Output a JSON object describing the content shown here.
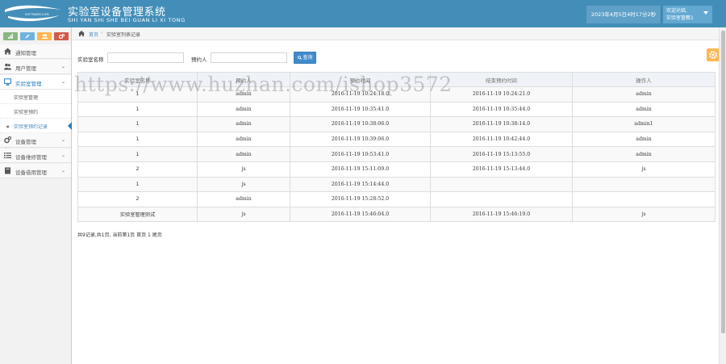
{
  "header": {
    "logo_text": "SOFTWARE.COM",
    "title": "实验室设备管理系统",
    "subtitle": "SHI YAN SHI SHE BEI GUAN LI XI TONG",
    "datetime": "2023年4月5日4时17分2秒",
    "welcome": "欢迎光临,",
    "username": "实验室管教1"
  },
  "sidebar": {
    "items": [
      {
        "label": "通知管理"
      },
      {
        "label": "用户管理"
      },
      {
        "label": "实验室管理"
      },
      {
        "label": "设备管理"
      },
      {
        "label": "设备维修管理"
      },
      {
        "label": "设备借用管理"
      }
    ],
    "sub_items": [
      {
        "label": "实验室管理"
      },
      {
        "label": "实验室预约"
      },
      {
        "label": "实验室预约记录"
      }
    ]
  },
  "breadcrumb": {
    "home": "首页",
    "current": "实验室列表记录"
  },
  "search": {
    "lab_label": "实验室名称",
    "person_label": "预约人",
    "button": "查询"
  },
  "table": {
    "headers": [
      "实验室名称",
      "预约人",
      "预约时间",
      "结束预约时间",
      "操作人"
    ],
    "rows": [
      [
        "1",
        "admin",
        "2016-11-19 10:24:18.0",
        "2016-11-19 10:24:21.0",
        "admin"
      ],
      [
        "1",
        "admin",
        "2016-11-19 10:35:41.0",
        "2016-11-19 10:35:44.0",
        "admin"
      ],
      [
        "1",
        "admin",
        "2016-11-19 10:38:06.0",
        "2016-11-19 10:38:14.0",
        "admin1"
      ],
      [
        "1",
        "admin",
        "2016-11-19 10:39:06.0",
        "2016-11-19 10:42:44.0",
        "admin"
      ],
      [
        "1",
        "admin",
        "2016-11-19 10:53:41.0",
        "2016-11-19 15:13:55.0",
        "admin"
      ],
      [
        "2",
        "js",
        "2016-11-19 15:11:09.0",
        "2016-11-19 15:13:44.0",
        "js"
      ],
      [
        "1",
        "js",
        "2016-11-19 15:14:44.0",
        "",
        ""
      ],
      [
        "2",
        "admin",
        "2016-11-19 15:28:52.0",
        "",
        ""
      ],
      [
        "实验室管理测试",
        "js",
        "2016-11-19 15:46:04.0",
        "2016-11-19 15:46:19.0",
        "js"
      ]
    ]
  },
  "pager": "共9记录,共1页, 当前第1页 首页 1 尾页",
  "watermark": "https://www.huzhan.com/ishop3572",
  "colors": {
    "header": "#438eb9",
    "accent": "#2b7dbc",
    "button": "#428bca"
  }
}
